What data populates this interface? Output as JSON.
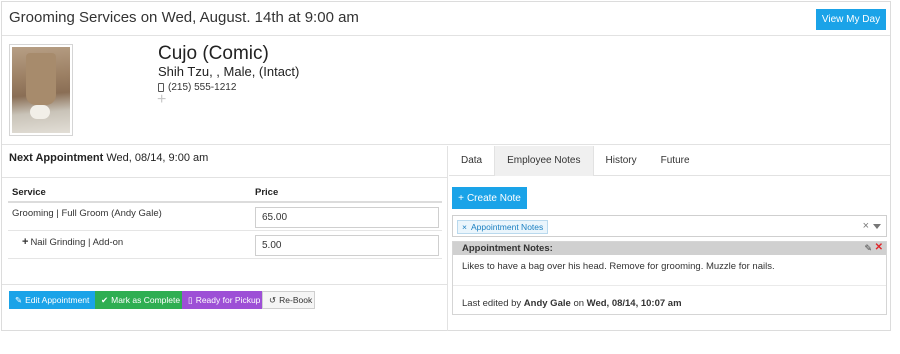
{
  "header": {
    "title": "Grooming Services on Wed, August. 14th at 9:00 am",
    "view_day_label": "View My Day"
  },
  "pet": {
    "name": "Cujo (Comic)",
    "description": "Shih Tzu, , Male, (Intact)",
    "phone": "(215) 555-1212",
    "add_symbol": "+"
  },
  "appointment": {
    "label": "Next Appointment",
    "datetime": "Wed, 08/14, 9:00 am"
  },
  "services": {
    "headers": {
      "service": "Service",
      "price": "Price"
    },
    "rows": [
      {
        "name": "Grooming | Full Groom (Andy Gale)",
        "price": "65.00"
      },
      {
        "name": "Nail Grinding | Add-on",
        "price": "5.00"
      }
    ]
  },
  "actions": {
    "edit": "Edit Appointment",
    "complete": "Mark as Complete",
    "pickup": "Ready for Pickup",
    "rebook": "Re-Book"
  },
  "tabs": [
    "Data",
    "Employee Notes",
    "History",
    "Future"
  ],
  "active_tab": "Employee Notes",
  "notes": {
    "create_label": "Create Note",
    "filter_tag": "Appointment Notes",
    "card_title": "Appointment Notes:",
    "body": "Likes to have a bag over his head. Remove for grooming. Muzzle for nails.",
    "footer_prefix": "Last edited by",
    "footer_author": "Andy Gale",
    "footer_on": "on",
    "footer_date": "Wed, 08/14, 10:07 am"
  },
  "colors": {
    "primary": "#1aa3e8",
    "success": "#2eae52",
    "purple": "#9d4fd6",
    "danger": "#e0262b"
  }
}
